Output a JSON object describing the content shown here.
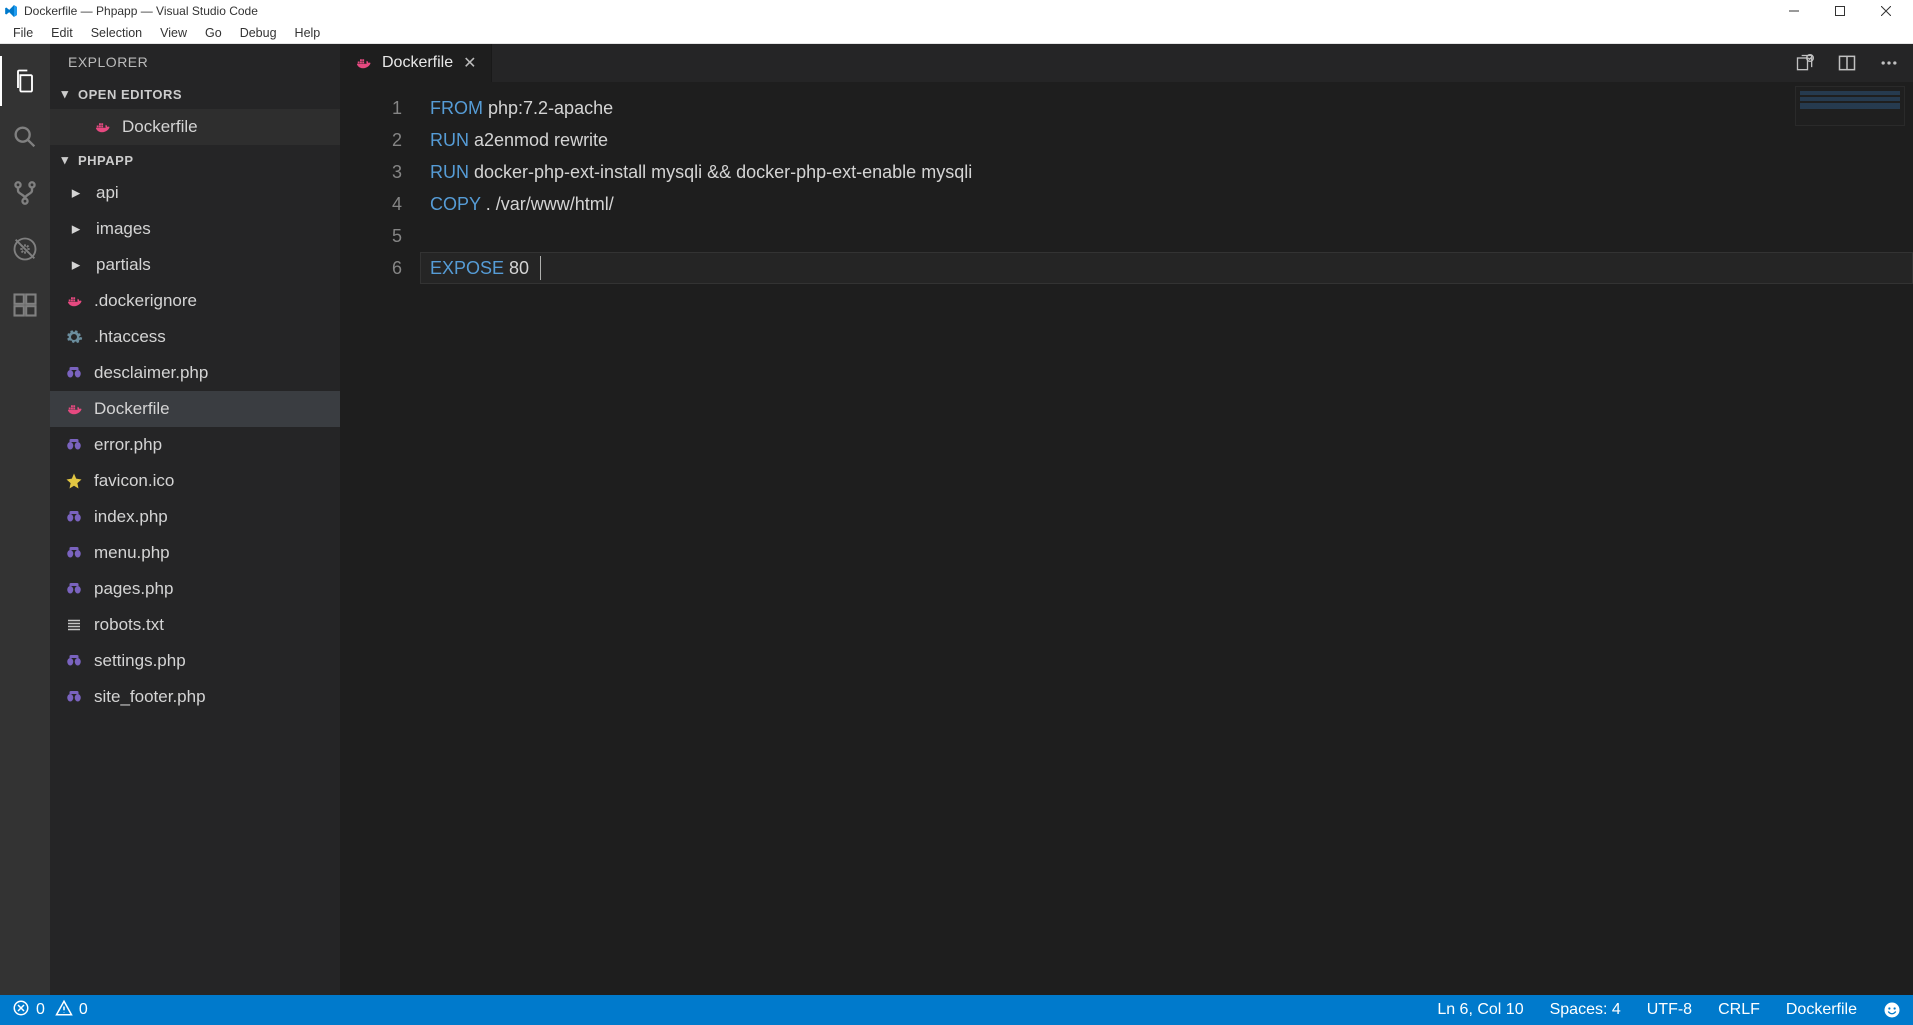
{
  "window": {
    "title": "Dockerfile — Phpapp — Visual Studio Code"
  },
  "menu": [
    "File",
    "Edit",
    "Selection",
    "View",
    "Go",
    "Debug",
    "Help"
  ],
  "sidebar": {
    "title": "EXPLORER",
    "open_editors_title": "OPEN EDITORS",
    "project_title": "PHPAPP",
    "open_editors": [
      {
        "name": "Dockerfile",
        "icon": "docker"
      }
    ],
    "tree": [
      {
        "kind": "folder",
        "name": "api"
      },
      {
        "kind": "folder",
        "name": "images"
      },
      {
        "kind": "folder",
        "name": "partials"
      },
      {
        "kind": "file",
        "name": ".dockerignore",
        "icon": "docker"
      },
      {
        "kind": "file",
        "name": ".htaccess",
        "icon": "gear"
      },
      {
        "kind": "file",
        "name": "desclaimer.php",
        "icon": "php"
      },
      {
        "kind": "file",
        "name": "Dockerfile",
        "icon": "docker",
        "selected": true
      },
      {
        "kind": "file",
        "name": "error.php",
        "icon": "php"
      },
      {
        "kind": "file",
        "name": "favicon.ico",
        "icon": "star"
      },
      {
        "kind": "file",
        "name": "index.php",
        "icon": "php"
      },
      {
        "kind": "file",
        "name": "menu.php",
        "icon": "php"
      },
      {
        "kind": "file",
        "name": "pages.php",
        "icon": "php"
      },
      {
        "kind": "file",
        "name": "robots.txt",
        "icon": "lines"
      },
      {
        "kind": "file",
        "name": "settings.php",
        "icon": "php"
      },
      {
        "kind": "file",
        "name": "site_footer.php",
        "icon": "php"
      }
    ]
  },
  "editor": {
    "tab_label": "Dockerfile",
    "lines": [
      {
        "n": "1",
        "kw": "FROM",
        "rest": " php:7.2-apache"
      },
      {
        "n": "2",
        "kw": "RUN",
        "rest": " a2enmod rewrite"
      },
      {
        "n": "3",
        "kw": "RUN",
        "rest": " docker-php-ext-install mysqli && docker-php-ext-enable mysqli"
      },
      {
        "n": "4",
        "kw": "COPY",
        "rest": " . /var/www/html/"
      },
      {
        "n": "5",
        "kw": "",
        "rest": ""
      },
      {
        "n": "6",
        "kw": "EXPOSE",
        "rest": " 80",
        "current": true
      }
    ]
  },
  "status": {
    "errors": "0",
    "warnings": "0",
    "position": "Ln 6, Col 10",
    "spaces": "Spaces: 4",
    "encoding": "UTF-8",
    "eol": "CRLF",
    "language": "Dockerfile"
  },
  "colors": {
    "accent": "#007acc"
  }
}
